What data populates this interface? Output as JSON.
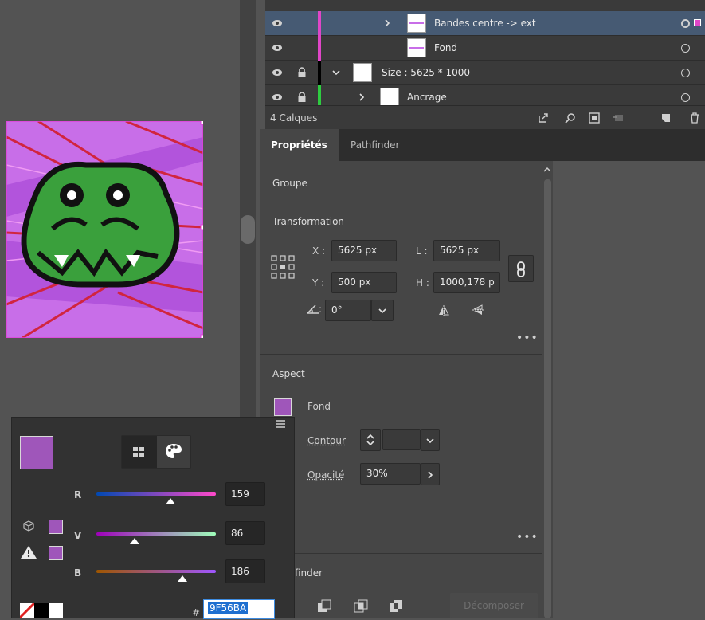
{
  "layers": {
    "rows": [
      {
        "name": "Bandes centre -> ext",
        "bar_color": "#e046c8",
        "locked": false,
        "expanded": false,
        "selected": true
      },
      {
        "name": "Fond",
        "bar_color": "#e046c8",
        "locked": false,
        "expanded": false,
        "selected": false
      },
      {
        "name": "Size : 5625 * 1000",
        "bar_color": "#000000",
        "locked": true,
        "expanded": true,
        "selected": false
      },
      {
        "name": "Ancrage",
        "bar_color": "#2ecc40",
        "locked": true,
        "expanded": false,
        "selected": false
      }
    ],
    "count_label": "4 Calques"
  },
  "tabs": {
    "properties": "Propriétés",
    "pathfinder": "Pathfinder"
  },
  "group": {
    "label": "Groupe"
  },
  "transform": {
    "title": "Transformation",
    "x_label": "X :",
    "x_value": "5625 px",
    "y_label": "Y :",
    "y_value": "500 px",
    "w_label": "L :",
    "w_value": "5625 px",
    "h_label": "H :",
    "h_value": "1000,178 p",
    "angle_value": "0°",
    "more": "•••"
  },
  "aspect": {
    "title": "Aspect",
    "fill_label": "Fond",
    "stroke_label": "Contour",
    "opacity_label": "Opacité",
    "opacity_value": "30%",
    "more": "•••"
  },
  "pathfinder_section": {
    "title_partial": "finder",
    "expand_label": "Décomposer"
  },
  "color_panel": {
    "swatch_color": "#9f56ba",
    "r_label": "R",
    "r_value": "159",
    "v_label": "V",
    "v_value": "86",
    "b_label": "B",
    "b_value": "186",
    "hex_prefix": "#",
    "hex_value": "9F56BA"
  },
  "colors": {
    "accent": "#9f56ba",
    "selection": "#465a73",
    "hex_highlight": "#1e6fd0"
  }
}
